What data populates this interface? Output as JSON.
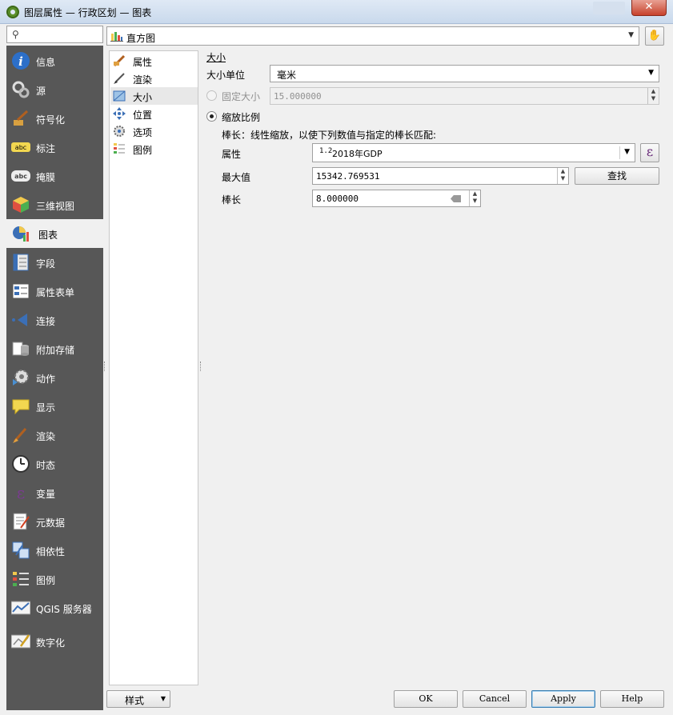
{
  "window": {
    "title": "图层属性 — 行政区划 — 图表",
    "close": "✕"
  },
  "search": {
    "placeholder": ""
  },
  "sidebar": {
    "items": [
      {
        "label": "信息",
        "icon": "info-icon"
      },
      {
        "label": "源",
        "icon": "source-icon"
      },
      {
        "label": "符号化",
        "icon": "symbology-icon"
      },
      {
        "label": "标注",
        "icon": "labels-icon"
      },
      {
        "label": "掩膜",
        "icon": "mask-icon"
      },
      {
        "label": "三维视图",
        "icon": "3d-view-icon"
      },
      {
        "label": "图表",
        "icon": "diagrams-icon",
        "active": true
      },
      {
        "label": "字段",
        "icon": "fields-icon"
      },
      {
        "label": "属性表单",
        "icon": "attributes-form-icon"
      },
      {
        "label": "连接",
        "icon": "joins-icon"
      },
      {
        "label": "附加存储",
        "icon": "auxiliary-storage-icon"
      },
      {
        "label": "动作",
        "icon": "actions-icon"
      },
      {
        "label": "显示",
        "icon": "display-icon"
      },
      {
        "label": "渲染",
        "icon": "rendering-icon"
      },
      {
        "label": "时态",
        "icon": "temporal-icon"
      },
      {
        "label": "变量",
        "icon": "variables-icon"
      },
      {
        "label": "元数据",
        "icon": "metadata-icon"
      },
      {
        "label": "相依性",
        "icon": "dependencies-icon"
      },
      {
        "label": "图例",
        "icon": "legend-icon"
      },
      {
        "label": "QGIS 服务器",
        "icon": "qgis-server-icon"
      },
      {
        "label": "数字化",
        "icon": "digitizing-icon"
      }
    ]
  },
  "renderer": {
    "value": "直方图"
  },
  "subnav": {
    "items": [
      {
        "label": "属性"
      },
      {
        "label": "渲染"
      },
      {
        "label": "大小",
        "active": true
      },
      {
        "label": "位置"
      },
      {
        "label": "选项"
      },
      {
        "label": "图例"
      }
    ]
  },
  "size": {
    "section_title": "大小",
    "unit_label": "大小单位",
    "unit_value": "毫米",
    "fixed_label": "固定大小",
    "fixed_value": "15.000000",
    "scaled_label": "缩放比例",
    "scaled_desc": "棒长：线性缩放，以使下列数值与指定的棒长匹配:",
    "attribute_label": "属性",
    "attribute_prefix": "1.2",
    "attribute_value": "2018年GDP",
    "max_label": "最大值",
    "max_value": "15342.769531",
    "find_button": "查找",
    "bar_length_label": "棒长",
    "bar_length_value": "8.000000",
    "epsilon": "ε"
  },
  "footer": {
    "style_label": "样式",
    "ok": "OK",
    "cancel": "Cancel",
    "apply": "Apply",
    "help": "Help"
  }
}
